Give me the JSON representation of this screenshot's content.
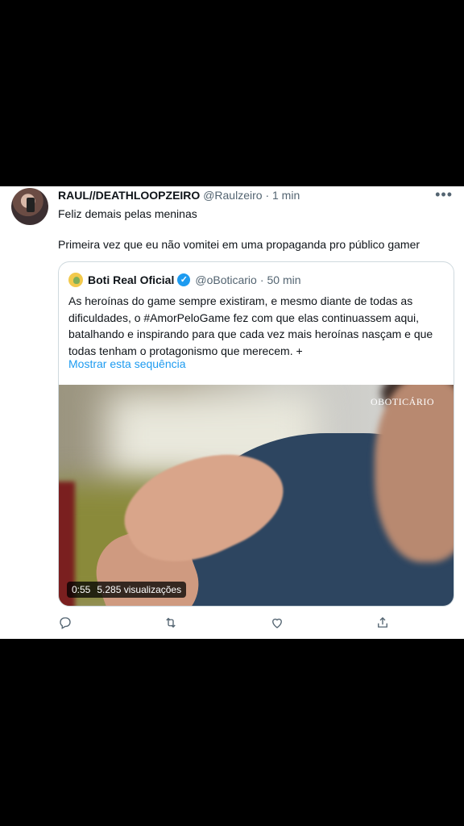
{
  "tweet": {
    "display_name": "RAUL//DEATHLOOPZEIRO",
    "handle": "@Raulzeiro",
    "separator": "·",
    "time": "1 min",
    "more_icon": "more-horizontal-icon",
    "line1": "Feliz demais pelas meninas",
    "line2": "Primeira vez que eu não vomitei em uma propaganda pro público gamer"
  },
  "quoted": {
    "display_name": "Boti Real Oficial",
    "verified_glyph": "✓",
    "handle": "@oBoticario",
    "separator": "·",
    "time": "50 min",
    "body": "As heroínas do game sempre existiram, e mesmo diante de todas as dificuldades, o #AmorPeloGame fez com que elas continuassem aqui, batalhando e inspirando para que cada vez mais heroínas nasçam e que todas tenham o protagonismo que merecem. +",
    "show_thread": "Mostrar esta sequência",
    "media": {
      "watermark": "OBOTICÁRIO",
      "duration": "0:55",
      "views": "5.285 visualizações"
    }
  },
  "actions": {
    "reply_icon": "reply-icon",
    "retweet_icon": "retweet-icon",
    "like_icon": "heart-icon",
    "share_icon": "share-icon"
  },
  "colors": {
    "link": "#1d9bf0",
    "secondary_text": "#536471",
    "background_outer": "#000000"
  }
}
